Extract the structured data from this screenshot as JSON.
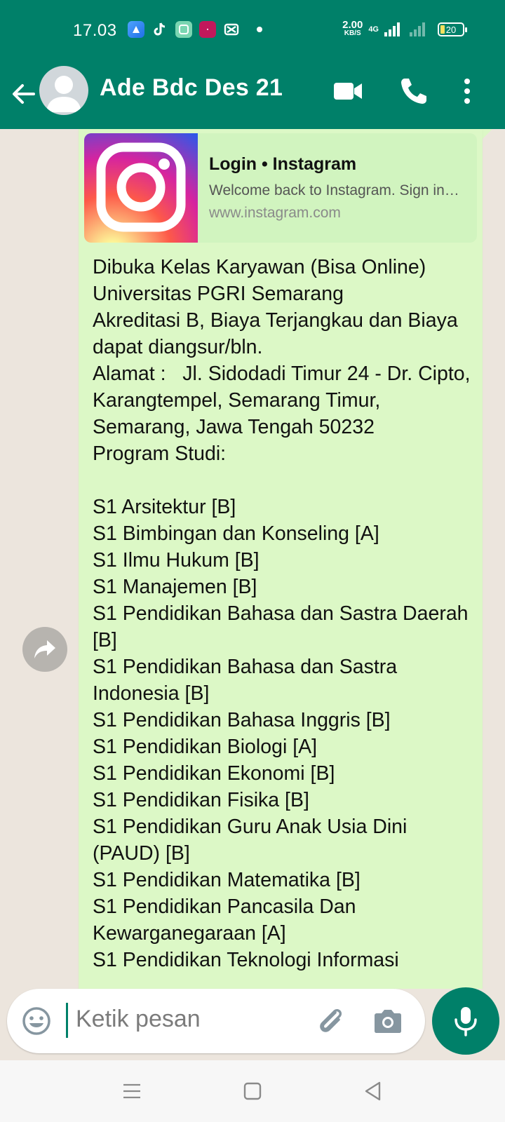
{
  "status_bar": {
    "time": "17.03",
    "net_speed_value": "2.00",
    "net_speed_unit": "KB/S",
    "network_type": "4G",
    "battery_level": "20"
  },
  "header": {
    "contact_name": "Ade Bdc Des 21"
  },
  "message": {
    "link_preview": {
      "title": "Login • Instagram",
      "description": "Welcome back to Instagram. Sign in to check out what your friends, family & interests have been capturing & sharing around the world.",
      "url": "www.instagram.com"
    },
    "body": "Dibuka Kelas Karyawan (Bisa Online)\nUniversitas PGRI Semarang\nAkreditasi B, Biaya Terjangkau dan Biaya dapat diangsur/bln.\nAlamat :   Jl. Sidodadi Timur 24 - Dr. Cipto, Karangtempel, Semarang Timur, Semarang, Jawa Tengah 50232\nProgram Studi:\n\nS1 Arsitektur [B]\nS1 Bimbingan dan Konseling [A]\nS1 Ilmu Hukum [B]\nS1 Manajemen [B]\nS1 Pendidikan Bahasa dan Sastra Daerah [B]\nS1 Pendidikan Bahasa dan Sastra Indonesia [B]\nS1 Pendidikan Bahasa Inggris [B]\nS1 Pendidikan Biologi [A]\nS1 Pendidikan Ekonomi [B]\nS1 Pendidikan Fisika [B]\nS1 Pendidikan Guru Anak Usia Dini (PAUD) [B]\nS1 Pendidikan Matematika [B]\nS1 Pendidikan Pancasila Dan Kewarganegaraan [A]\nS1 Pendidikan Teknologi Informasi"
  },
  "input": {
    "placeholder": "Ketik pesan"
  },
  "colors": {
    "header_bg": "#008069",
    "bubble_bg": "#dcf8c6",
    "chat_bg": "#ece5dd"
  },
  "icons": {
    "back": "arrow-left-icon",
    "video": "video-call-icon",
    "call": "phone-icon",
    "menu": "more-vert-icon",
    "forward": "forward-icon",
    "emoji": "emoji-icon",
    "attach": "paperclip-icon",
    "camera": "camera-icon",
    "mic": "mic-icon"
  }
}
